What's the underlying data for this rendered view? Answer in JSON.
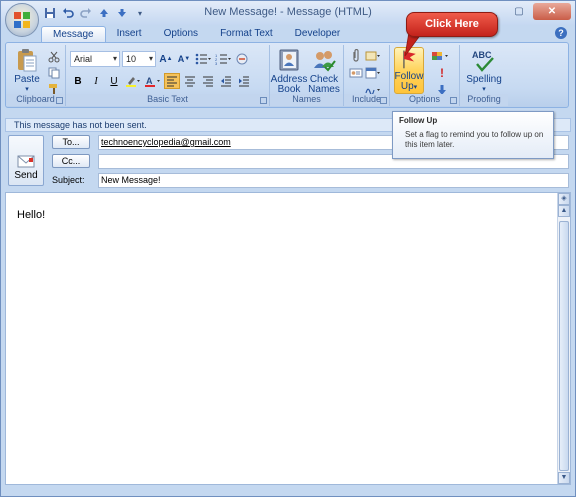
{
  "window": {
    "title": "New Message! - Message (HTML)"
  },
  "quick_access": [
    {
      "icon": "save-icon"
    },
    {
      "icon": "undo-icon"
    },
    {
      "icon": "redo-icon"
    },
    {
      "icon": "up-arrow-icon"
    },
    {
      "icon": "down-arrow-icon"
    }
  ],
  "tabs": [
    {
      "label": "Message",
      "active": true
    },
    {
      "label": "Insert"
    },
    {
      "label": "Options"
    },
    {
      "label": "Format Text"
    },
    {
      "label": "Developer"
    }
  ],
  "ribbon": {
    "clipboard": {
      "label": "Clipboard",
      "paste": "Paste"
    },
    "basic_text": {
      "label": "Basic Text",
      "font": "Arial",
      "size": "10",
      "bold": "B",
      "italic": "I",
      "underline": "U"
    },
    "names": {
      "label": "Names",
      "address_book_1": "Address",
      "address_book_2": "Book",
      "check_names_1": "Check",
      "check_names_2": "Names"
    },
    "include": {
      "label": "Include"
    },
    "options": {
      "label": "Options",
      "follow_up_1": "Follow",
      "follow_up_2": "Up"
    },
    "proofing": {
      "label": "Proofing",
      "spelling": "Spelling",
      "abc": "ABC"
    }
  },
  "callout": {
    "text": "Click Here",
    "color": "#d8322a"
  },
  "tooltip": {
    "title": "Follow Up",
    "body": "Set a flag to remind you to follow up on this item later."
  },
  "infobar": {
    "text": "This message has not been sent."
  },
  "compose": {
    "send_label": "Send",
    "to_label": "To...",
    "cc_label": "Cc...",
    "subject_label": "Subject:",
    "to_value": "technoencyclopedia@gmail.com",
    "cc_value": "",
    "subject_value": "New Message!"
  },
  "body": {
    "text": "Hello!"
  }
}
